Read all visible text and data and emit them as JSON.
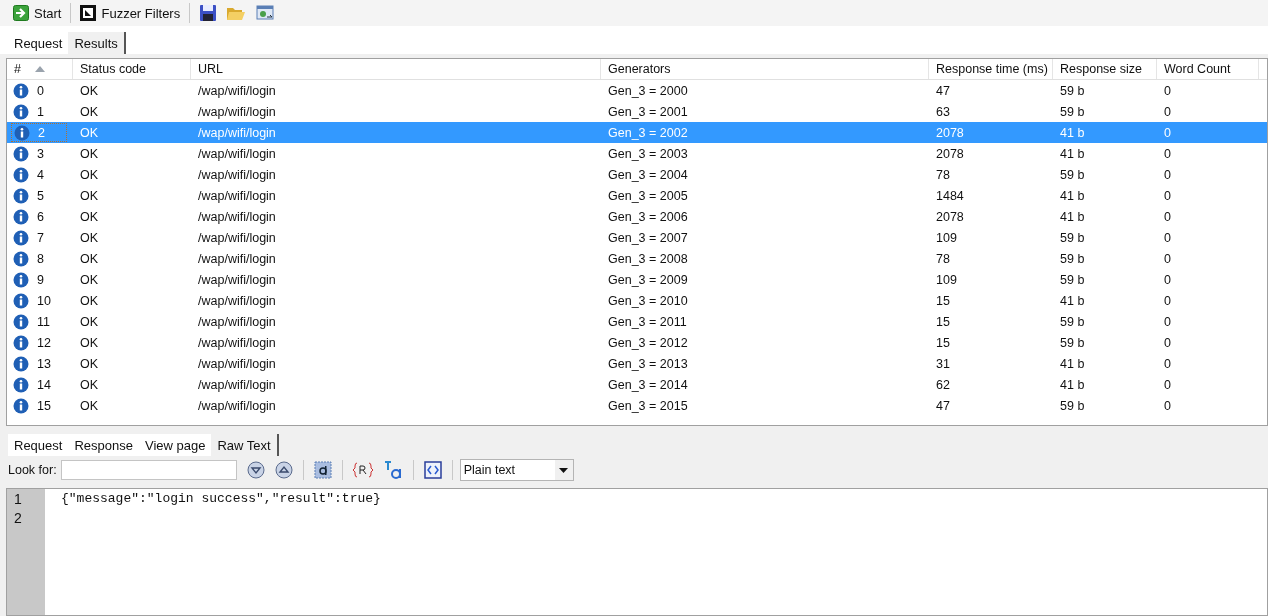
{
  "toolbar": {
    "start": "Start",
    "fuzzer_filters": "Fuzzer Filters"
  },
  "tabs": [
    {
      "label": "Request",
      "selected": false
    },
    {
      "label": "Results",
      "selected": true
    }
  ],
  "table": {
    "columns": [
      {
        "label": "#",
        "sorted": true
      },
      {
        "label": "Status code",
        "sorted": false
      },
      {
        "label": "URL",
        "sorted": false
      },
      {
        "label": "Generators",
        "sorted": false
      },
      {
        "label": "Response time (ms)",
        "sorted": false
      },
      {
        "label": "Response size",
        "sorted": false
      },
      {
        "label": "Word Count",
        "sorted": false
      }
    ],
    "rows": [
      {
        "cells": [
          "0",
          "OK",
          "/wap/wifi/login",
          "Gen_3 = 2000",
          "47",
          "59 b",
          "0"
        ],
        "selected": false
      },
      {
        "cells": [
          "1",
          "OK",
          "/wap/wifi/login",
          "Gen_3 = 2001",
          "63",
          "59 b",
          "0"
        ],
        "selected": false
      },
      {
        "cells": [
          "2",
          "OK",
          "/wap/wifi/login",
          "Gen_3 = 2002",
          "2078",
          "41 b",
          "0"
        ],
        "selected": true
      },
      {
        "cells": [
          "3",
          "OK",
          "/wap/wifi/login",
          "Gen_3 = 2003",
          "2078",
          "41 b",
          "0"
        ],
        "selected": false
      },
      {
        "cells": [
          "4",
          "OK",
          "/wap/wifi/login",
          "Gen_3 = 2004",
          "78",
          "59 b",
          "0"
        ],
        "selected": false
      },
      {
        "cells": [
          "5",
          "OK",
          "/wap/wifi/login",
          "Gen_3 = 2005",
          "1484",
          "41 b",
          "0"
        ],
        "selected": false
      },
      {
        "cells": [
          "6",
          "OK",
          "/wap/wifi/login",
          "Gen_3 = 2006",
          "2078",
          "41 b",
          "0"
        ],
        "selected": false
      },
      {
        "cells": [
          "7",
          "OK",
          "/wap/wifi/login",
          "Gen_3 = 2007",
          "109",
          "59 b",
          "0"
        ],
        "selected": false
      },
      {
        "cells": [
          "8",
          "OK",
          "/wap/wifi/login",
          "Gen_3 = 2008",
          "78",
          "59 b",
          "0"
        ],
        "selected": false
      },
      {
        "cells": [
          "9",
          "OK",
          "/wap/wifi/login",
          "Gen_3 = 2009",
          "109",
          "59 b",
          "0"
        ],
        "selected": false
      },
      {
        "cells": [
          "10",
          "OK",
          "/wap/wifi/login",
          "Gen_3 = 2010",
          "15",
          "41 b",
          "0"
        ],
        "selected": false
      },
      {
        "cells": [
          "11",
          "OK",
          "/wap/wifi/login",
          "Gen_3 = 2011",
          "15",
          "59 b",
          "0"
        ],
        "selected": false
      },
      {
        "cells": [
          "12",
          "OK",
          "/wap/wifi/login",
          "Gen_3 = 2012",
          "15",
          "59 b",
          "0"
        ],
        "selected": false
      },
      {
        "cells": [
          "13",
          "OK",
          "/wap/wifi/login",
          "Gen_3 = 2013",
          "31",
          "41 b",
          "0"
        ],
        "selected": false
      },
      {
        "cells": [
          "14",
          "OK",
          "/wap/wifi/login",
          "Gen_3 = 2014",
          "62",
          "41 b",
          "0"
        ],
        "selected": false
      },
      {
        "cells": [
          "15",
          "OK",
          "/wap/wifi/login",
          "Gen_3 = 2015",
          "47",
          "59 b",
          "0"
        ],
        "selected": false
      }
    ]
  },
  "response_tabs": [
    {
      "label": "Request",
      "selected": false
    },
    {
      "label": "Response",
      "selected": false
    },
    {
      "label": "View page",
      "selected": false
    },
    {
      "label": "Raw Text",
      "selected": true
    }
  ],
  "search": {
    "label": "Look for:",
    "format": "Plain text"
  },
  "editor": {
    "lines": [
      {
        "number": "1",
        "text": "{\"message\":\"login success\",\"result\":true}"
      },
      {
        "number": "2"
      }
    ]
  }
}
